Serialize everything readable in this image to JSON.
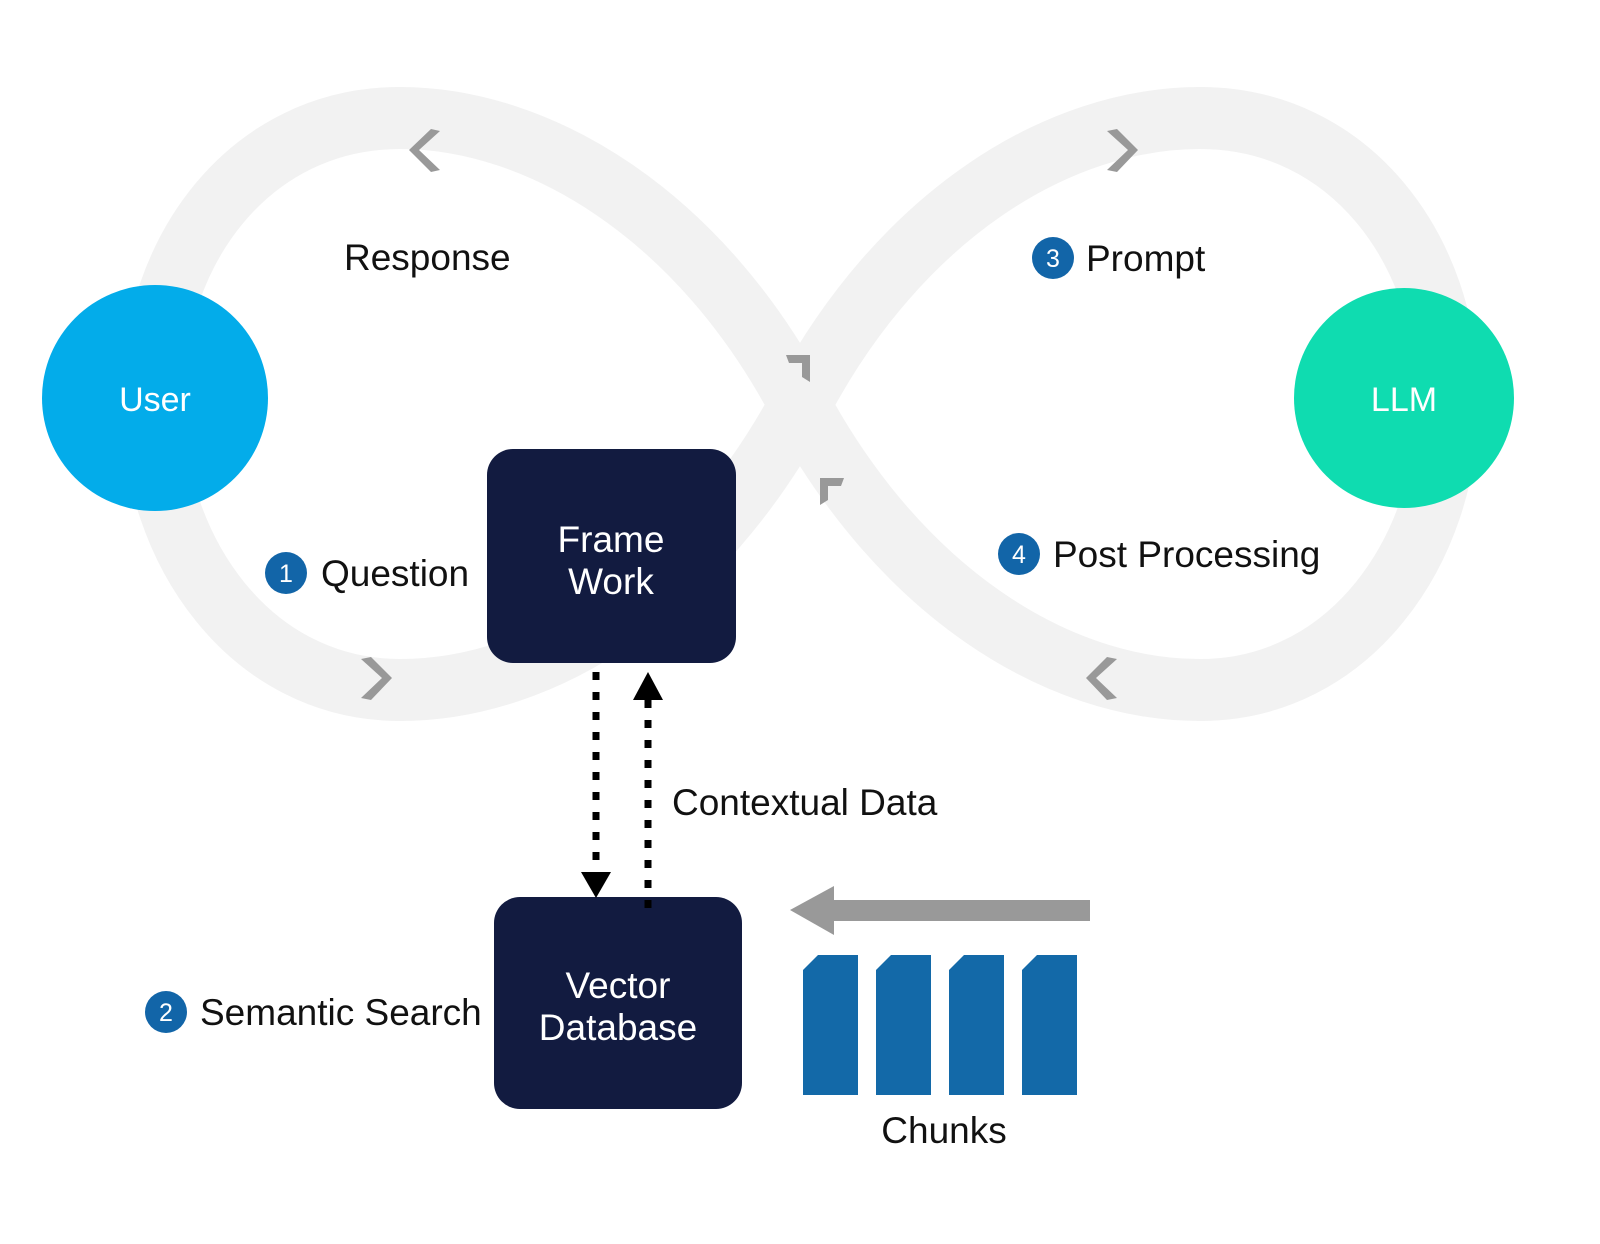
{
  "colors": {
    "loop_band": "#F2F2F2",
    "loop_arrow": "#999999",
    "user_circle": "#03ACEA",
    "llm_circle": "#0FDCB0",
    "box_navy": "#121B40",
    "badge_blue": "#1265A8",
    "chunk_blue": "#1369A8",
    "chunk_arrow": "#999999",
    "dotted_arrow": "#000000",
    "text_dark": "#111111",
    "text_light": "#FFFFFF",
    "background": "#FFFFFF"
  },
  "nodes": {
    "user": {
      "label": "User"
    },
    "llm": {
      "label": "LLM"
    },
    "framework": {
      "line1": "Frame",
      "line2": "Work"
    },
    "vector_database": {
      "line1": "Vector",
      "line2": "Database"
    }
  },
  "flows": [
    {
      "id": "response",
      "label": "Response",
      "number": null
    },
    {
      "id": "question",
      "label": "Question",
      "number": "1"
    },
    {
      "id": "prompt",
      "label": "Prompt",
      "number": "3"
    },
    {
      "id": "post_processing",
      "label": "Post Processing",
      "number": "4"
    },
    {
      "id": "semantic_search",
      "label": "Semantic Search",
      "number": "2"
    },
    {
      "id": "contextual_data",
      "label": "Contextual Data",
      "number": null
    }
  ],
  "labels": {
    "response": "Response",
    "question": "Question",
    "prompt": "Prompt",
    "post_processing": "Post Processing",
    "semantic_search": "Semantic Search",
    "contextual_data": "Contextual Data",
    "chunks": "Chunks"
  },
  "badges": {
    "question": "1",
    "semantic_search": "2",
    "prompt": "3",
    "post_processing": "4"
  },
  "chunks": {
    "caption": "Chunks",
    "count": 4
  }
}
